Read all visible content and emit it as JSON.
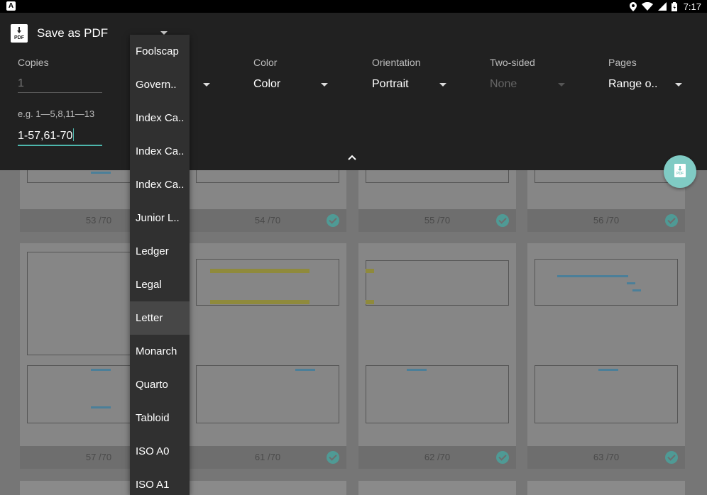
{
  "status_bar": {
    "app_badge": "A",
    "time": "7:17",
    "icons": [
      "location-icon",
      "wifi-icon",
      "signal-icon",
      "battery-icon"
    ]
  },
  "header": {
    "title": "Save as PDF",
    "icon_label": "PDF"
  },
  "fields": {
    "copies": {
      "label": "Copies",
      "value": "1"
    },
    "paper_size": {
      "value": "Govern.."
    },
    "color": {
      "label": "Color",
      "value": "Color"
    },
    "orientation": {
      "label": "Orientation",
      "value": "Portrait"
    },
    "two_sided": {
      "label": "Two-sided",
      "value": "None"
    },
    "pages": {
      "label": "Pages",
      "value": "Range o.."
    },
    "range_hint": "e.g. 1—5,8,11—13",
    "range_value": "1-57,61-70"
  },
  "fab": {
    "icon_label": "PDF"
  },
  "paper_menu": {
    "items": [
      "Foolscap",
      "Govern..",
      "Index Ca..",
      "Index Ca..",
      "Index Ca..",
      "Junior L..",
      "Ledger",
      "Legal",
      "Letter",
      "Monarch",
      "Quarto",
      "Tabloid",
      "ISO A0",
      "ISO A1"
    ],
    "selected": "Letter"
  },
  "pages": {
    "row1": [
      "53 /70",
      "54 /70",
      "55 /70",
      "56 /70"
    ],
    "row2": [
      "57 /70",
      "61 /70",
      "62 /70",
      "63 /70"
    ]
  },
  "colors": {
    "accent": "#4db6ac",
    "panel_bg": "#212121",
    "menu_bg": "#303030",
    "fab_bg": "#80cbc4"
  }
}
